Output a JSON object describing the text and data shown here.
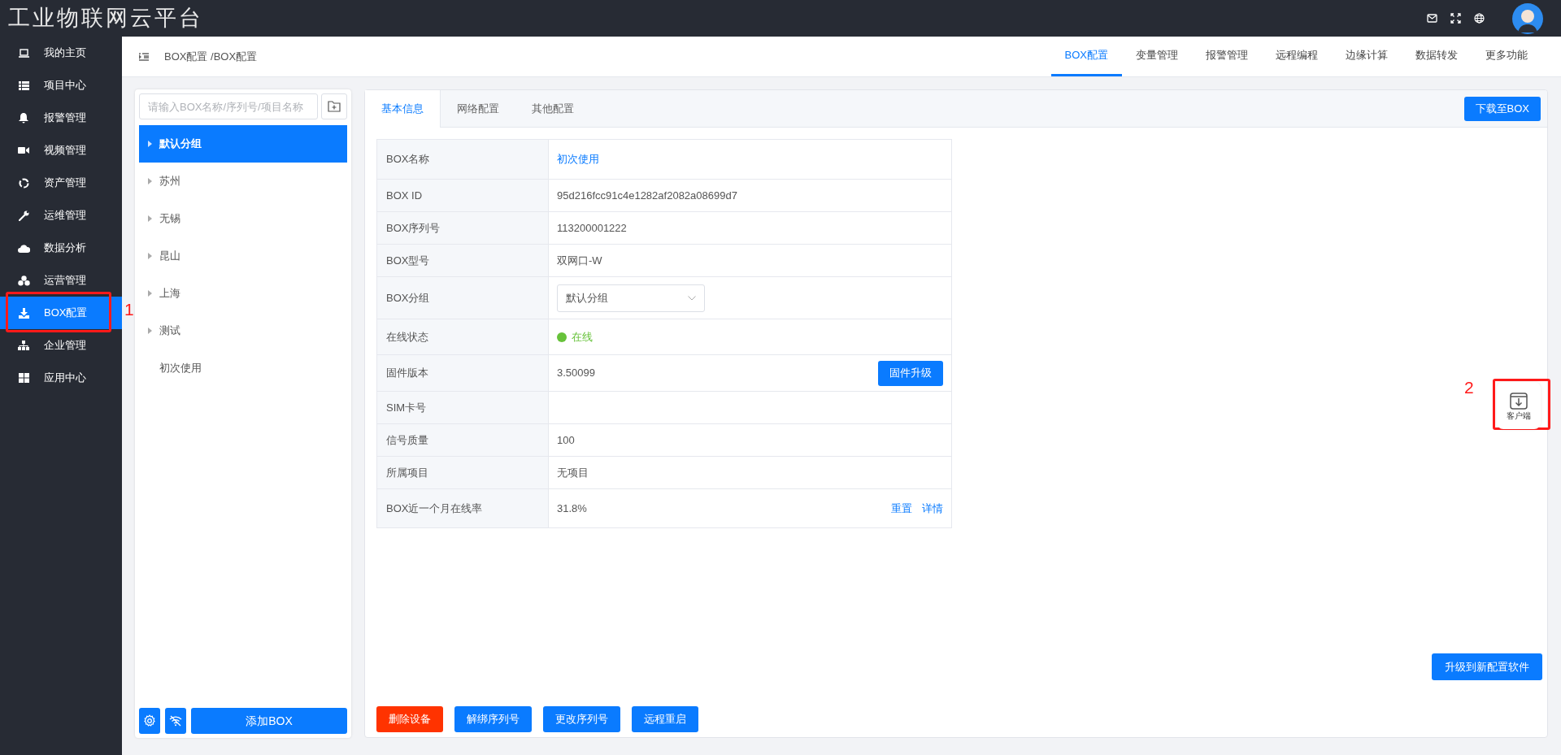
{
  "app": {
    "title": "工业物联网云平台"
  },
  "sidebar": {
    "items": [
      {
        "label": "我的主页",
        "selected": false
      },
      {
        "label": "项目中心",
        "selected": false
      },
      {
        "label": "报警管理",
        "selected": false
      },
      {
        "label": "视频管理",
        "selected": false
      },
      {
        "label": "资产管理",
        "selected": false
      },
      {
        "label": "运维管理",
        "selected": false
      },
      {
        "label": "数据分析",
        "selected": false
      },
      {
        "label": "运营管理",
        "selected": false
      },
      {
        "label": "BOX配置",
        "selected": true
      },
      {
        "label": "企业管理",
        "selected": false
      },
      {
        "label": "应用中心",
        "selected": false
      }
    ]
  },
  "breadcrumb": "BOX配置 /BOX配置",
  "top_tabs": [
    {
      "label": "BOX配置",
      "selected": true
    },
    {
      "label": "变量管理",
      "selected": false
    },
    {
      "label": "报警管理",
      "selected": false
    },
    {
      "label": "远程编程",
      "selected": false
    },
    {
      "label": "边缘计算",
      "selected": false
    },
    {
      "label": "数据转发",
      "selected": false
    },
    {
      "label": "更多功能",
      "selected": false
    }
  ],
  "box_tree": {
    "search": {
      "placeholder": "请输入BOX名称/序列号/项目名称"
    },
    "groups": [
      {
        "label": "默认分组",
        "selected": true,
        "expandable": true
      },
      {
        "label": "苏州",
        "selected": false,
        "expandable": true
      },
      {
        "label": "无锡",
        "selected": false,
        "expandable": true
      },
      {
        "label": "昆山",
        "selected": false,
        "expandable": true
      },
      {
        "label": "上海",
        "selected": false,
        "expandable": true
      },
      {
        "label": "测试",
        "selected": false,
        "expandable": true
      },
      {
        "label": "初次使用",
        "selected": false,
        "expandable": false
      }
    ],
    "add_button": "添加BOX"
  },
  "detail": {
    "tabs": [
      {
        "label": "基本信息",
        "selected": true
      },
      {
        "label": "网络配置",
        "selected": false
      },
      {
        "label": "其他配置",
        "selected": false
      }
    ],
    "download_button": "下载至BOX",
    "rows": [
      {
        "kind": "link",
        "label": "BOX名称",
        "value": "初次使用"
      },
      {
        "kind": "text",
        "label": "BOX ID",
        "value": "95d216fcc91c4e1282af2082a08699d7"
      },
      {
        "kind": "text",
        "label": "BOX序列号",
        "value": "113200001222"
      },
      {
        "kind": "text",
        "label": "BOX型号",
        "value": "双网口-W"
      },
      {
        "kind": "select",
        "label": "BOX分组",
        "value": "默认分组"
      },
      {
        "kind": "status",
        "label": "在线状态",
        "value": "在线",
        "online": true
      },
      {
        "kind": "button",
        "label": "固件版本",
        "value": "3.50099",
        "button": "固件升级"
      },
      {
        "kind": "text",
        "label": "SIM卡号"
      },
      {
        "kind": "text",
        "label": "信号质量",
        "value": "100"
      },
      {
        "kind": "text",
        "label": "所属项目",
        "value": "无项目"
      },
      {
        "kind": "links",
        "label": "BOX近一个月在线率",
        "value": "31.8%",
        "links": [
          "重置",
          "详情"
        ]
      }
    ],
    "upgrade_button": "升级到新配置软件",
    "actions": [
      {
        "label": "删除设备",
        "kind": "danger"
      },
      {
        "label": "解绑序列号",
        "kind": "primary"
      },
      {
        "label": "更改序列号",
        "kind": "primary"
      },
      {
        "label": "远程重启",
        "kind": "primary"
      }
    ]
  },
  "client_button": {
    "label": "客户端"
  },
  "annotations": [
    {
      "label": "1"
    },
    {
      "label": "2"
    }
  ]
}
